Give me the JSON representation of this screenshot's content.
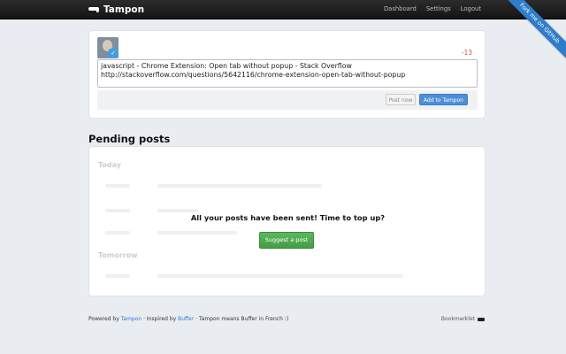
{
  "topbar": {
    "brand": "Tampon",
    "nav": [
      "Dashboard",
      "Settings",
      "Logout"
    ],
    "ribbon": "Fork me on GitHub"
  },
  "composer": {
    "counter": "-13",
    "text": "javascript - Chrome Extension: Open tab without popup - Stack Overflow\nhttp://stackoverflow.com/questions/5642116/chrome-extension-open-tab-without-popup",
    "post_now": "Post now",
    "add": "Add to Tampon"
  },
  "pending": {
    "title": "Pending posts",
    "days": [
      "Today",
      "Tomorrow"
    ],
    "empty_message": "All your posts have been sent! Time to top up?",
    "suggest": "Suggest a post"
  },
  "footer": {
    "powered_by": "Powered by",
    "tampon": "Tampon",
    "inspired_by": " · Inspired by ",
    "buffer": "Buffer",
    "tagline": " · Tampon means Buffer in French :)",
    "bookmarklet": "Bookmarklet"
  }
}
